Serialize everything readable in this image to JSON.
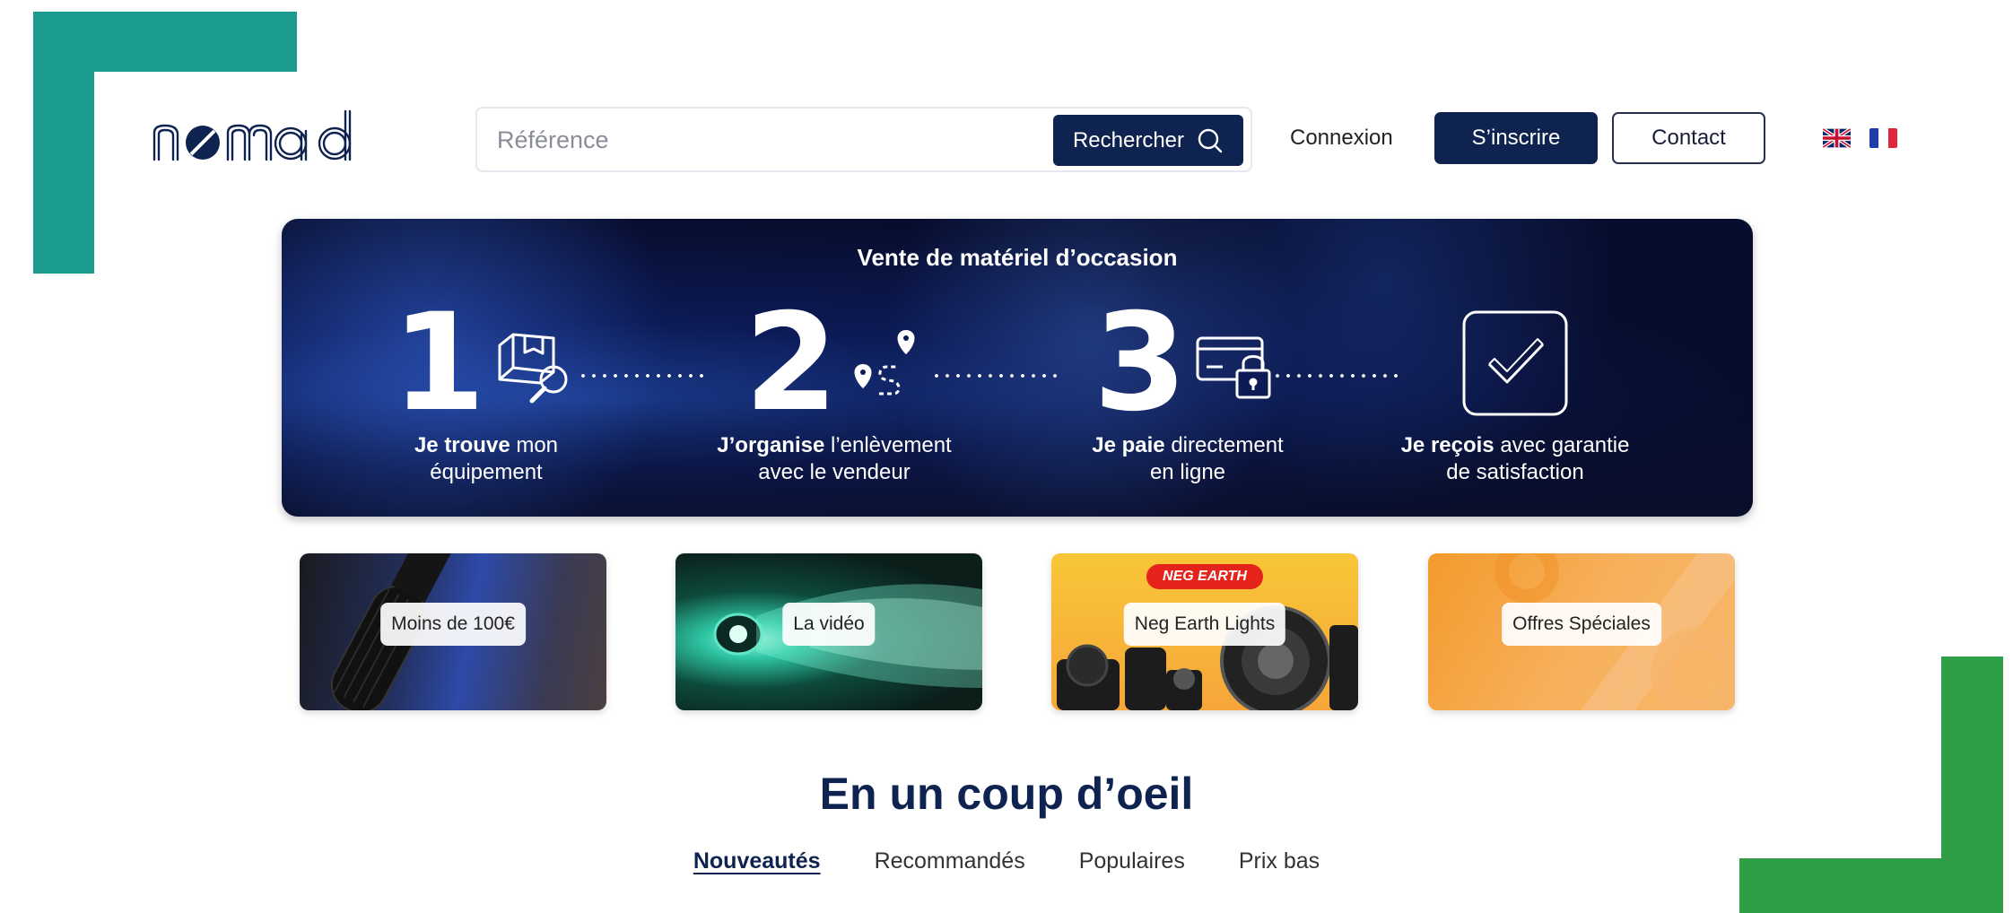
{
  "brand": {
    "logo_text": "nomad"
  },
  "header": {
    "search_placeholder": "Référence",
    "search_button": "Rechercher",
    "login_link": "Connexion",
    "signup_button": "S’inscrire",
    "contact_button": "Contact",
    "languages": [
      "English",
      "Français"
    ]
  },
  "hero": {
    "title": "Vente de matériel d’occasion",
    "steps": [
      {
        "number": "1",
        "bold": "Je trouve",
        "rest": " mon",
        "line2": "équipement",
        "icon": "box-search-icon"
      },
      {
        "number": "2",
        "bold": "J’organise",
        "rest": " l’enlèvement",
        "line2": "avec le vendeur",
        "icon": "route-pins-icon"
      },
      {
        "number": "3",
        "bold": "Je paie",
        "rest": " directement",
        "line2": "en ligne",
        "icon": "card-lock-icon"
      },
      {
        "number": "",
        "bold": "Je reçois",
        "rest": " avec garantie",
        "line2": "de satisfaction",
        "icon": "checkbox-icon"
      }
    ]
  },
  "categories": [
    {
      "label": "Moins de 100€"
    },
    {
      "label": "La vidéo"
    },
    {
      "label": "Neg Earth Lights",
      "brand_logo": "NEG EARTH"
    },
    {
      "label": "Offres Spéciales"
    }
  ],
  "section": {
    "title": "En un coup d’oeil",
    "tabs": [
      "Nouveautés",
      "Recommandés",
      "Populaires",
      "Prix bas"
    ],
    "active_tab": "Nouveautés"
  },
  "colors": {
    "navy": "#0f2350",
    "teal_corner": "#1c9b8f",
    "green_corner": "#2e9f47"
  }
}
